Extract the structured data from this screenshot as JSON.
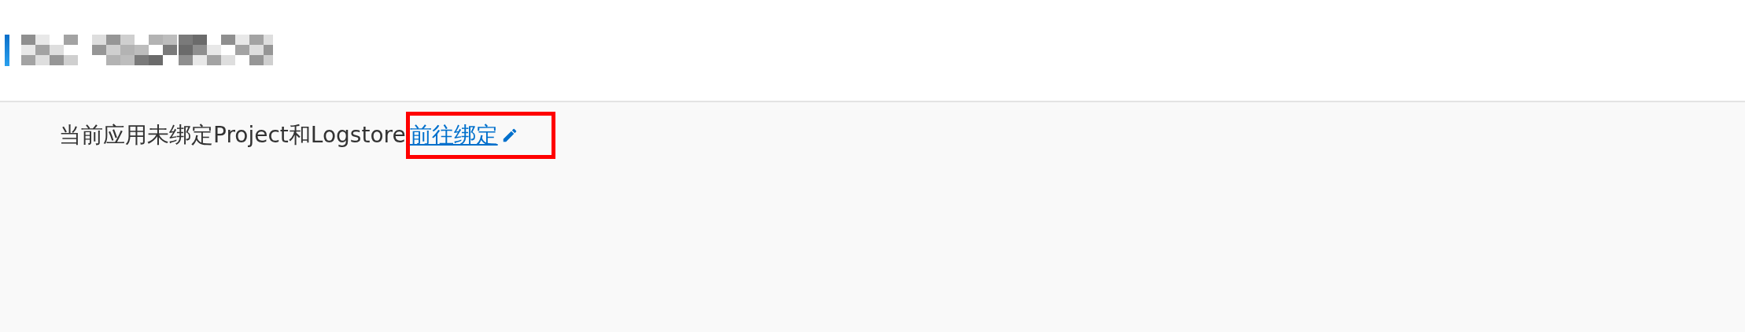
{
  "header": {
    "title_redacted": true
  },
  "notice": {
    "text": "当前应用未绑定Project和Logstore",
    "link": {
      "text": "前往绑定",
      "highlighted": true
    }
  }
}
